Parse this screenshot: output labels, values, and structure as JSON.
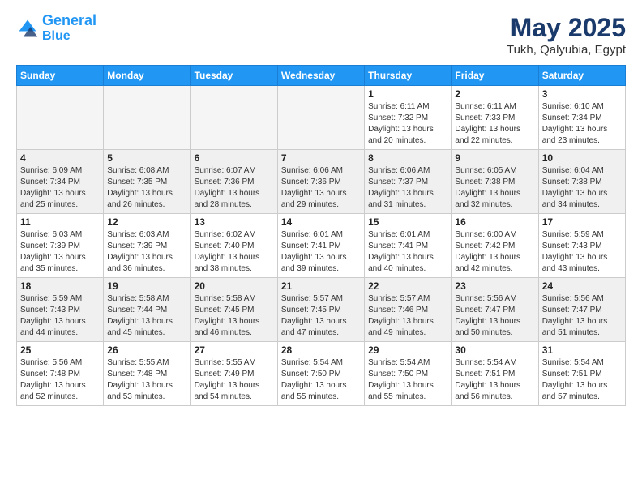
{
  "header": {
    "logo_line1": "General",
    "logo_line2": "Blue",
    "title": "May 2025",
    "subtitle": "Tukh, Qalyubia, Egypt"
  },
  "weekdays": [
    "Sunday",
    "Monday",
    "Tuesday",
    "Wednesday",
    "Thursday",
    "Friday",
    "Saturday"
  ],
  "weeks": [
    [
      {
        "day": "",
        "info": ""
      },
      {
        "day": "",
        "info": ""
      },
      {
        "day": "",
        "info": ""
      },
      {
        "day": "",
        "info": ""
      },
      {
        "day": "1",
        "info": "Sunrise: 6:11 AM\nSunset: 7:32 PM\nDaylight: 13 hours\nand 20 minutes."
      },
      {
        "day": "2",
        "info": "Sunrise: 6:11 AM\nSunset: 7:33 PM\nDaylight: 13 hours\nand 22 minutes."
      },
      {
        "day": "3",
        "info": "Sunrise: 6:10 AM\nSunset: 7:34 PM\nDaylight: 13 hours\nand 23 minutes."
      }
    ],
    [
      {
        "day": "4",
        "info": "Sunrise: 6:09 AM\nSunset: 7:34 PM\nDaylight: 13 hours\nand 25 minutes."
      },
      {
        "day": "5",
        "info": "Sunrise: 6:08 AM\nSunset: 7:35 PM\nDaylight: 13 hours\nand 26 minutes."
      },
      {
        "day": "6",
        "info": "Sunrise: 6:07 AM\nSunset: 7:36 PM\nDaylight: 13 hours\nand 28 minutes."
      },
      {
        "day": "7",
        "info": "Sunrise: 6:06 AM\nSunset: 7:36 PM\nDaylight: 13 hours\nand 29 minutes."
      },
      {
        "day": "8",
        "info": "Sunrise: 6:06 AM\nSunset: 7:37 PM\nDaylight: 13 hours\nand 31 minutes."
      },
      {
        "day": "9",
        "info": "Sunrise: 6:05 AM\nSunset: 7:38 PM\nDaylight: 13 hours\nand 32 minutes."
      },
      {
        "day": "10",
        "info": "Sunrise: 6:04 AM\nSunset: 7:38 PM\nDaylight: 13 hours\nand 34 minutes."
      }
    ],
    [
      {
        "day": "11",
        "info": "Sunrise: 6:03 AM\nSunset: 7:39 PM\nDaylight: 13 hours\nand 35 minutes."
      },
      {
        "day": "12",
        "info": "Sunrise: 6:03 AM\nSunset: 7:39 PM\nDaylight: 13 hours\nand 36 minutes."
      },
      {
        "day": "13",
        "info": "Sunrise: 6:02 AM\nSunset: 7:40 PM\nDaylight: 13 hours\nand 38 minutes."
      },
      {
        "day": "14",
        "info": "Sunrise: 6:01 AM\nSunset: 7:41 PM\nDaylight: 13 hours\nand 39 minutes."
      },
      {
        "day": "15",
        "info": "Sunrise: 6:01 AM\nSunset: 7:41 PM\nDaylight: 13 hours\nand 40 minutes."
      },
      {
        "day": "16",
        "info": "Sunrise: 6:00 AM\nSunset: 7:42 PM\nDaylight: 13 hours\nand 42 minutes."
      },
      {
        "day": "17",
        "info": "Sunrise: 5:59 AM\nSunset: 7:43 PM\nDaylight: 13 hours\nand 43 minutes."
      }
    ],
    [
      {
        "day": "18",
        "info": "Sunrise: 5:59 AM\nSunset: 7:43 PM\nDaylight: 13 hours\nand 44 minutes."
      },
      {
        "day": "19",
        "info": "Sunrise: 5:58 AM\nSunset: 7:44 PM\nDaylight: 13 hours\nand 45 minutes."
      },
      {
        "day": "20",
        "info": "Sunrise: 5:58 AM\nSunset: 7:45 PM\nDaylight: 13 hours\nand 46 minutes."
      },
      {
        "day": "21",
        "info": "Sunrise: 5:57 AM\nSunset: 7:45 PM\nDaylight: 13 hours\nand 47 minutes."
      },
      {
        "day": "22",
        "info": "Sunrise: 5:57 AM\nSunset: 7:46 PM\nDaylight: 13 hours\nand 49 minutes."
      },
      {
        "day": "23",
        "info": "Sunrise: 5:56 AM\nSunset: 7:47 PM\nDaylight: 13 hours\nand 50 minutes."
      },
      {
        "day": "24",
        "info": "Sunrise: 5:56 AM\nSunset: 7:47 PM\nDaylight: 13 hours\nand 51 minutes."
      }
    ],
    [
      {
        "day": "25",
        "info": "Sunrise: 5:56 AM\nSunset: 7:48 PM\nDaylight: 13 hours\nand 52 minutes."
      },
      {
        "day": "26",
        "info": "Sunrise: 5:55 AM\nSunset: 7:48 PM\nDaylight: 13 hours\nand 53 minutes."
      },
      {
        "day": "27",
        "info": "Sunrise: 5:55 AM\nSunset: 7:49 PM\nDaylight: 13 hours\nand 54 minutes."
      },
      {
        "day": "28",
        "info": "Sunrise: 5:54 AM\nSunset: 7:50 PM\nDaylight: 13 hours\nand 55 minutes."
      },
      {
        "day": "29",
        "info": "Sunrise: 5:54 AM\nSunset: 7:50 PM\nDaylight: 13 hours\nand 55 minutes."
      },
      {
        "day": "30",
        "info": "Sunrise: 5:54 AM\nSunset: 7:51 PM\nDaylight: 13 hours\nand 56 minutes."
      },
      {
        "day": "31",
        "info": "Sunrise: 5:54 AM\nSunset: 7:51 PM\nDaylight: 13 hours\nand 57 minutes."
      }
    ]
  ]
}
